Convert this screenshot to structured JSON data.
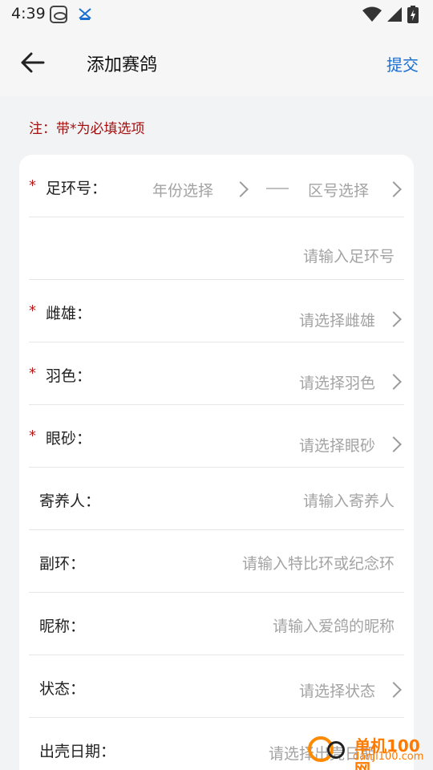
{
  "status_bar": {
    "time": "4:39",
    "icons": [
      "teamviewer-icon",
      "app-notification-icon",
      "wifi-icon",
      "signal-icon",
      "battery-charging-icon"
    ]
  },
  "header": {
    "title": "添加赛鸽",
    "submit_label": "提交",
    "back_icon": "arrow-left-icon",
    "accent_color": "#1a6fd0"
  },
  "note": "注：带*为必填选项",
  "form": {
    "required_mark": "*",
    "ring": {
      "label": "足环号：",
      "year_placeholder": "年份选择",
      "zone_placeholder": "区号选择",
      "number_placeholder": "请输入足环号"
    },
    "gender": {
      "label": "雌雄：",
      "placeholder": "请选择雌雄"
    },
    "feather": {
      "label": "羽色：",
      "placeholder": "请选择羽色"
    },
    "eye": {
      "label": "眼砂：",
      "placeholder": "请选择眼砂"
    },
    "keeper": {
      "label": "寄养人：",
      "placeholder": "请输入寄养人"
    },
    "sub_ring": {
      "label": "副环：",
      "placeholder": "请输入特比环或纪念环"
    },
    "nickname": {
      "label": "昵称：",
      "placeholder": "请输入爱鸽的昵称"
    },
    "status": {
      "label": "状态：",
      "placeholder": "请选择状态"
    },
    "hatch_date": {
      "label": "出壳日期：",
      "placeholder": "请选择出壳日期"
    }
  },
  "watermark": {
    "line1": "单机100网",
    "line2": "danji100.com"
  }
}
